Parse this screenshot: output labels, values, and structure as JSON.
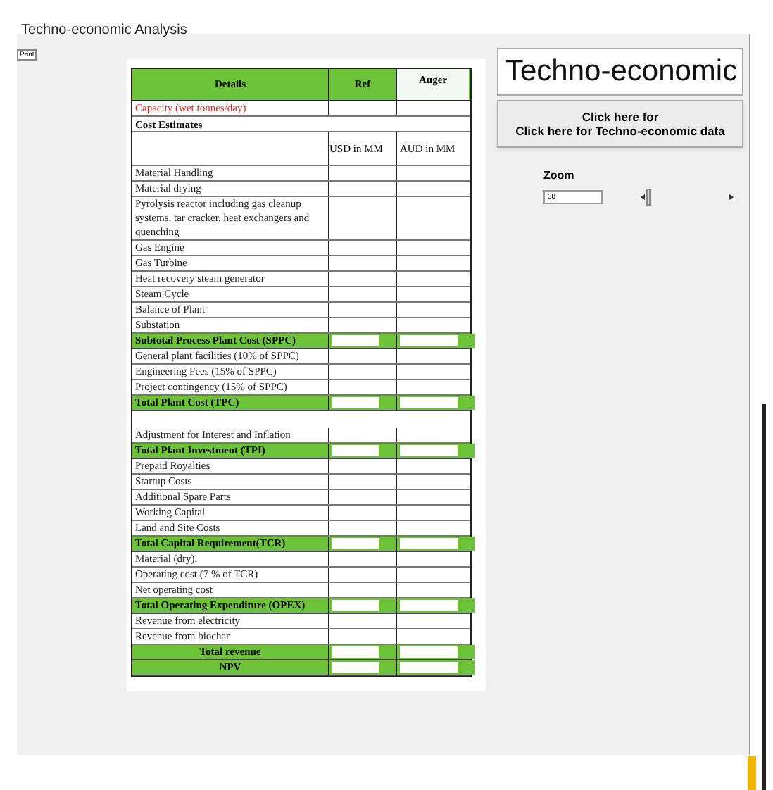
{
  "window": {
    "title": "Techno-economic Analysis"
  },
  "print_button": "Print",
  "table": {
    "columns": [
      "Details",
      "Ref",
      "Auger"
    ],
    "rows": [
      {
        "kind": "red",
        "label": "Capacity (wet tonnes/day)"
      },
      {
        "kind": "section",
        "label": "Cost Estimates"
      },
      {
        "kind": "units",
        "label": "",
        "ref": "USD in MM",
        "auger": "AUD in MM"
      },
      {
        "kind": "normal",
        "label": "Material Handling"
      },
      {
        "kind": "normal",
        "label": "Material drying"
      },
      {
        "kind": "normal",
        "label": "Pyrolysis reactor including gas cleanup systems, tar cracker, heat exchangers and quenching"
      },
      {
        "kind": "normal",
        "label": "Gas Engine"
      },
      {
        "kind": "normal",
        "label": "Gas Turbine"
      },
      {
        "kind": "normal",
        "label": "Heat recovery steam generator"
      },
      {
        "kind": "normal",
        "label": "Steam Cycle"
      },
      {
        "kind": "normal",
        "label": "Balance of Plant"
      },
      {
        "kind": "normal",
        "label": "Substation"
      },
      {
        "kind": "green",
        "label": "Subtotal Process Plant Cost (SPPC)"
      },
      {
        "kind": "normal",
        "label": "General plant facilities (10% of SPPC)"
      },
      {
        "kind": "normal",
        "label": "Engineering Fees (15% of SPPC)"
      },
      {
        "kind": "normal",
        "label": "Project contingency (15% of SPPC)"
      },
      {
        "kind": "green",
        "label": "Total Plant Cost (TPC)"
      },
      {
        "kind": "spacer",
        "label": ""
      },
      {
        "kind": "normal",
        "label": "Adjustment for Interest and Inflation"
      },
      {
        "kind": "green",
        "label": "Total Plant Investment (TPI)"
      },
      {
        "kind": "normal",
        "label": "Prepaid Royalties"
      },
      {
        "kind": "normal",
        "label": "Startup Costs"
      },
      {
        "kind": "normal",
        "label": "Additional Spare Parts"
      },
      {
        "kind": "normal",
        "label": "Working Capital"
      },
      {
        "kind": "normal",
        "label": "Land and Site Costs"
      },
      {
        "kind": "green",
        "label": "Total Capital Requirement(TCR)"
      },
      {
        "kind": "normal",
        "label": "Material (dry),"
      },
      {
        "kind": "normal",
        "label": "Operating cost (7 % of TCR)"
      },
      {
        "kind": "normal",
        "label": "Net operating cost"
      },
      {
        "kind": "green",
        "label": "Total Operating Expenditure (OPEX)"
      },
      {
        "kind": "normal",
        "label": "Revenue from electricity"
      },
      {
        "kind": "normal",
        "label": "Revenue from biochar"
      },
      {
        "kind": "total",
        "label": "Total revenue"
      },
      {
        "kind": "total",
        "label": "NPV"
      }
    ]
  },
  "side": {
    "title": "Techno-economic",
    "button": "Click here for\nClick here for Techno-economic data",
    "zoom_label": "Zoom",
    "zoom_value": "38",
    "zoom_slider": {
      "level": 0
    }
  }
}
